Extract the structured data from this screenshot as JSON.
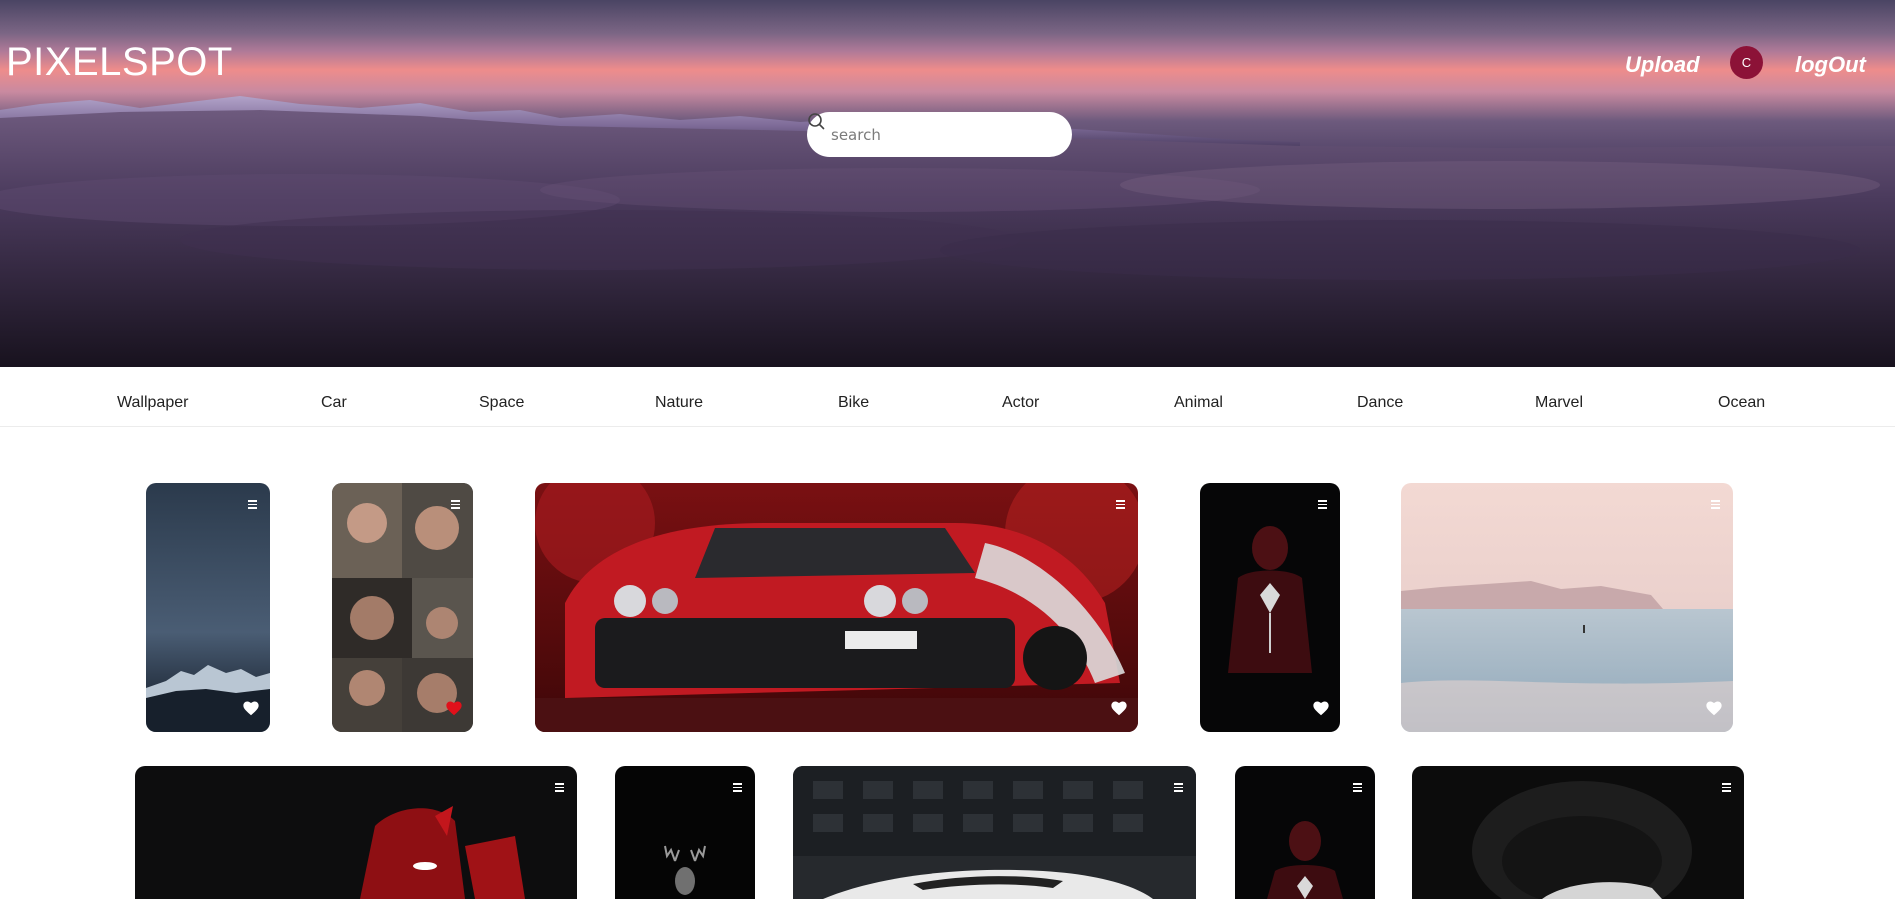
{
  "header": {
    "logo": "PIXELSPOT",
    "search_placeholder": "search",
    "upload_label": "Upload",
    "avatar_initial": "C",
    "logout_label": "logOut",
    "avatar_color": "#8c1237"
  },
  "categories": [
    "Wallpaper",
    "Car",
    "Space",
    "Nature",
    "Bike",
    "Actor",
    "Animal",
    "Dance",
    "Marvel",
    "Ocean"
  ],
  "gallery": {
    "row1": [
      {
        "subject": "night sky over snowy mountains",
        "liked": false
      },
      {
        "subject": "actor photo collage",
        "liked": true
      },
      {
        "subject": "red muscle car",
        "liked": false
      },
      {
        "subject": "spider-man on black",
        "liked": false
      },
      {
        "subject": "calm ocean at dusk",
        "liked": false
      }
    ],
    "row2": [
      {
        "subject": "deadpool mask splatter"
      },
      {
        "subject": "stag on black"
      },
      {
        "subject": "white sports car"
      },
      {
        "subject": "spider-man on black"
      },
      {
        "subject": "car in dark tunnel"
      }
    ]
  },
  "colors": {
    "heart_liked": "#e0101a",
    "heart_default": "#ffffff"
  }
}
